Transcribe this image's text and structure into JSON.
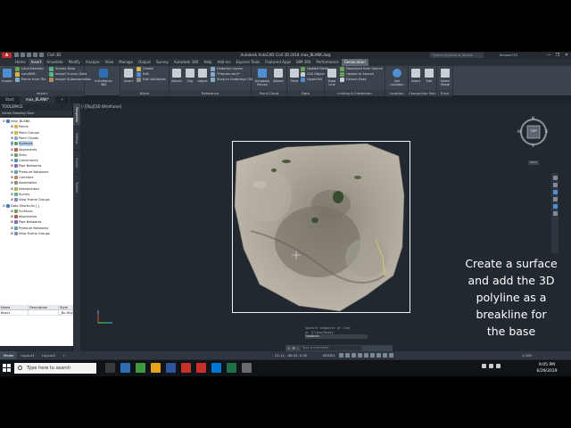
{
  "window": {
    "title": "Autodesk AutoCAD Civil 3D 2018   max_BLANK.dwg",
    "qat_label": "Civil 3D",
    "search_placeholder": "Type a keyword or phrase",
    "user": "bmaoer123",
    "controls": [
      "—",
      "❐",
      "✕"
    ]
  },
  "ribbon_tabs": [
    "Home",
    "Insert",
    "Annotate",
    "Modify",
    "Analyze",
    "View",
    "Manage",
    "Output",
    "Survey",
    "Autodesk 360",
    "Help",
    "Add-ins",
    "Express Tools",
    "Featured Apps",
    "BIM 360",
    "Performance",
    "Geolocation"
  ],
  "active_tab": "Insert",
  "highlight_tab": "Geolocation",
  "ribbon": {
    "import_panel": {
      "title": "Import",
      "big_import": "Import",
      "items": [
        "Land Desktop",
        "LandXML",
        "Points from File",
        "Survey Data",
        "Import Survey Data",
        "Import Subassemblies"
      ],
      "infraworks": "InfraWorks 360"
    },
    "block_panel": {
      "title": "Block",
      "insert": "Insert",
      "create": "Create",
      "edit": "Edit",
      "edit_attributes": "Edit Attributes"
    },
    "reference_panel": {
      "title": "Reference",
      "attach": "Attach",
      "clip": "Clip",
      "adjust": "Adjust",
      "underlay_layers": "Underlay Layers",
      "frames": "*Frames vary*",
      "snap": "Snap to Underlays ON"
    },
    "pointcloud_panel": {
      "title": "Point Cloud",
      "autodesk": "Autodesk ReCap",
      "attach": "Attach"
    },
    "data_panel": {
      "title": "Data",
      "field": "Field",
      "update_fields": "Update Fields",
      "ole": "OLE Object",
      "hyperlink": "Hyperlink"
    },
    "linking_panel": {
      "title": "Linking & Extraction",
      "data_link": "Data Link",
      "download": "Download from Source",
      "upload": "Upload to Source",
      "extract": "Extract Data"
    },
    "location_panel": {
      "title": "Location",
      "set_location": "Set Location"
    },
    "connection_panel": {
      "title": "Connection Point",
      "insert": "Insert",
      "edit": "Edit"
    },
    "truck_panel": {
      "title": "Truck",
      "select": "Select Mode"
    }
  },
  "file_tabs": [
    "Start",
    "max_BLANK*",
    "+"
  ],
  "toolspace": {
    "title": "TOOLSPACE",
    "subtitle": "Active Drawing View",
    "tree": [
      {
        "label": "max_BLANK",
        "level": 0,
        "icon": "#4b7fc2"
      },
      {
        "label": "Points",
        "level": 1,
        "icon": "#d9b44a"
      },
      {
        "label": "Point Groups",
        "level": 1,
        "icon": "#d9b44a"
      },
      {
        "label": "Point Clouds",
        "level": 1,
        "icon": "#8aa8c9"
      },
      {
        "label": "Surfaces",
        "level": 1,
        "icon": "#6aa15a",
        "selected": true
      },
      {
        "label": "Alignments",
        "level": 1,
        "icon": "#b35a5a"
      },
      {
        "label": "Sites",
        "level": 1,
        "icon": "#7a9a5a"
      },
      {
        "label": "Catchments",
        "level": 1,
        "icon": "#5a8ab3"
      },
      {
        "label": "Pipe Networks",
        "level": 1,
        "icon": "#8a6ab3"
      },
      {
        "label": "Pressure Networks",
        "level": 1,
        "icon": "#5aa3b3"
      },
      {
        "label": "Corridors",
        "level": 1,
        "icon": "#b38a5a"
      },
      {
        "label": "Assemblies",
        "level": 1,
        "icon": "#8a8a8a"
      },
      {
        "label": "Intersections",
        "level": 1,
        "icon": "#b3b35a"
      },
      {
        "label": "Survey",
        "level": 1,
        "icon": "#5ab38a"
      },
      {
        "label": "View Frame Groups",
        "level": 1,
        "icon": "#8a8ab3"
      },
      {
        "label": "Data Shortcuts [ ]",
        "level": 0,
        "icon": "#4b7fc2"
      },
      {
        "label": "Surfaces",
        "level": 1,
        "icon": "#6aa15a"
      },
      {
        "label": "Alignments",
        "level": 1,
        "icon": "#b35a5a"
      },
      {
        "label": "Pipe Networks",
        "level": 1,
        "icon": "#8a6ab3"
      },
      {
        "label": "Pressure Networks",
        "level": 1,
        "icon": "#5aa3b3"
      },
      {
        "label": "View Frame Groups",
        "level": 1,
        "icon": "#8a8ab3"
      }
    ],
    "vertical_tabs": [
      "Prospector",
      "Settings",
      "Survey",
      "Toolbox"
    ],
    "grid": {
      "headers": [
        "Name",
        "Description",
        "Style"
      ],
      "rows": [
        [
          "Base1",
          "",
          "_No Disp"
        ]
      ]
    }
  },
  "canvas": {
    "view_label": "[-][Top][2D Wireframe]",
    "viewcube": {
      "top": "TOP",
      "n": "N",
      "s": "S",
      "e": "E",
      "w": "W",
      "wcs": "WCS"
    },
    "overlay_text": [
      "Create a surface",
      "and add the 3D",
      "polyline as a",
      "breakline for",
      "the base"
    ],
    "command_history": [
      "Specify endpoint of line",
      "or [Close/Undo]:",
      "Command:"
    ],
    "command_placeholder": "Type a command"
  },
  "statusbar": {
    "layout_tabs": [
      "Model",
      "Layout1",
      "Layout2",
      "+"
    ],
    "coords": "22.11, -96.43, 0.00",
    "model": "MODEL",
    "scale": "1:100"
  },
  "taskbar": {
    "search_placeholder": "Type here to search",
    "time": "9:05 PM",
    "date": "6/29/2019",
    "apps": [
      "#3a3a3a",
      "#2f6db5",
      "#3f9a3f",
      "#e5a21a",
      "#2b579a",
      "#c8312a",
      "#c8312a",
      "#0078d7",
      "#1e7145",
      "#6a6a6a"
    ]
  }
}
